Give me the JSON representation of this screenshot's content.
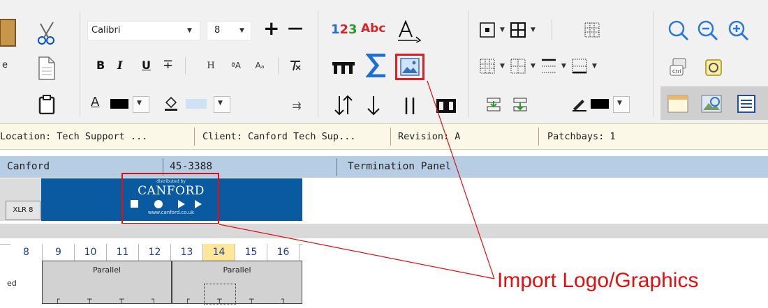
{
  "toolbar": {
    "font_name": "Calibri",
    "font_size": "8",
    "increase_font_glyph": "+",
    "decrease_font_glyph": "—",
    "bold_label": "B",
    "italic_label": "I",
    "underline_label": "U",
    "strike_label": "∓",
    "number_label": "123",
    "abc_label": "Abc",
    "partial_edit_label": "e",
    "font_color": "#000000",
    "fill_color": "#cfe2f3"
  },
  "info_bar": {
    "location": "Location: Tech Support ...",
    "client": "Client: Canford Tech Sup...",
    "revision": "Revision: A",
    "patchbays": "Patchbays: 1"
  },
  "detail_bar": {
    "company": "Canford",
    "part_number": "45-3388",
    "description": "Termination Panel"
  },
  "panel": {
    "connector_label": "XLR 8",
    "logo_distributed": "distributed by",
    "logo_name": "CANFORD",
    "logo_url": "www.canford.co.uk",
    "logo_bg_color": "#0a5aa1"
  },
  "columns": [
    "8",
    "9",
    "10",
    "11",
    "12",
    "13",
    "14",
    "15",
    "16"
  ],
  "selected_column": "14",
  "group_left_label": "ed",
  "groups": [
    {
      "label": "Parallel"
    },
    {
      "label": "Parallel"
    }
  ],
  "callout": {
    "text": "Import Logo/Graphics",
    "color": "#e01010"
  },
  "icons": {
    "cut": "scissors-icon",
    "copy": "copy-icon",
    "paste": "clipboard-icon",
    "import_logo": "image-icon",
    "zoom": "magnifier-icon"
  }
}
